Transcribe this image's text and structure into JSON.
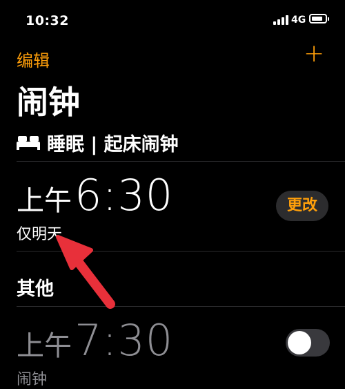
{
  "status_bar": {
    "time": "10:32",
    "network": "4G",
    "battery_level": 0.85
  },
  "nav": {
    "edit_label": "编辑",
    "add_label": "+"
  },
  "page": {
    "title": "闹钟"
  },
  "sleep_section": {
    "icon": "bed-icon",
    "label": "睡眠 | 起床闹钟"
  },
  "alarms": [
    {
      "ampm": "上午",
      "time": "6:30",
      "subtitle": "仅明天",
      "action_label": "更改"
    }
  ],
  "other_section": {
    "label": "其他"
  },
  "other_alarms": [
    {
      "ampm": "上午",
      "time": "7:30",
      "subtitle": "闹钟",
      "enabled": false
    }
  ],
  "colors": {
    "accent": "#ff9f0a",
    "background": "#000000",
    "annotation_arrow": "#e8303a"
  }
}
